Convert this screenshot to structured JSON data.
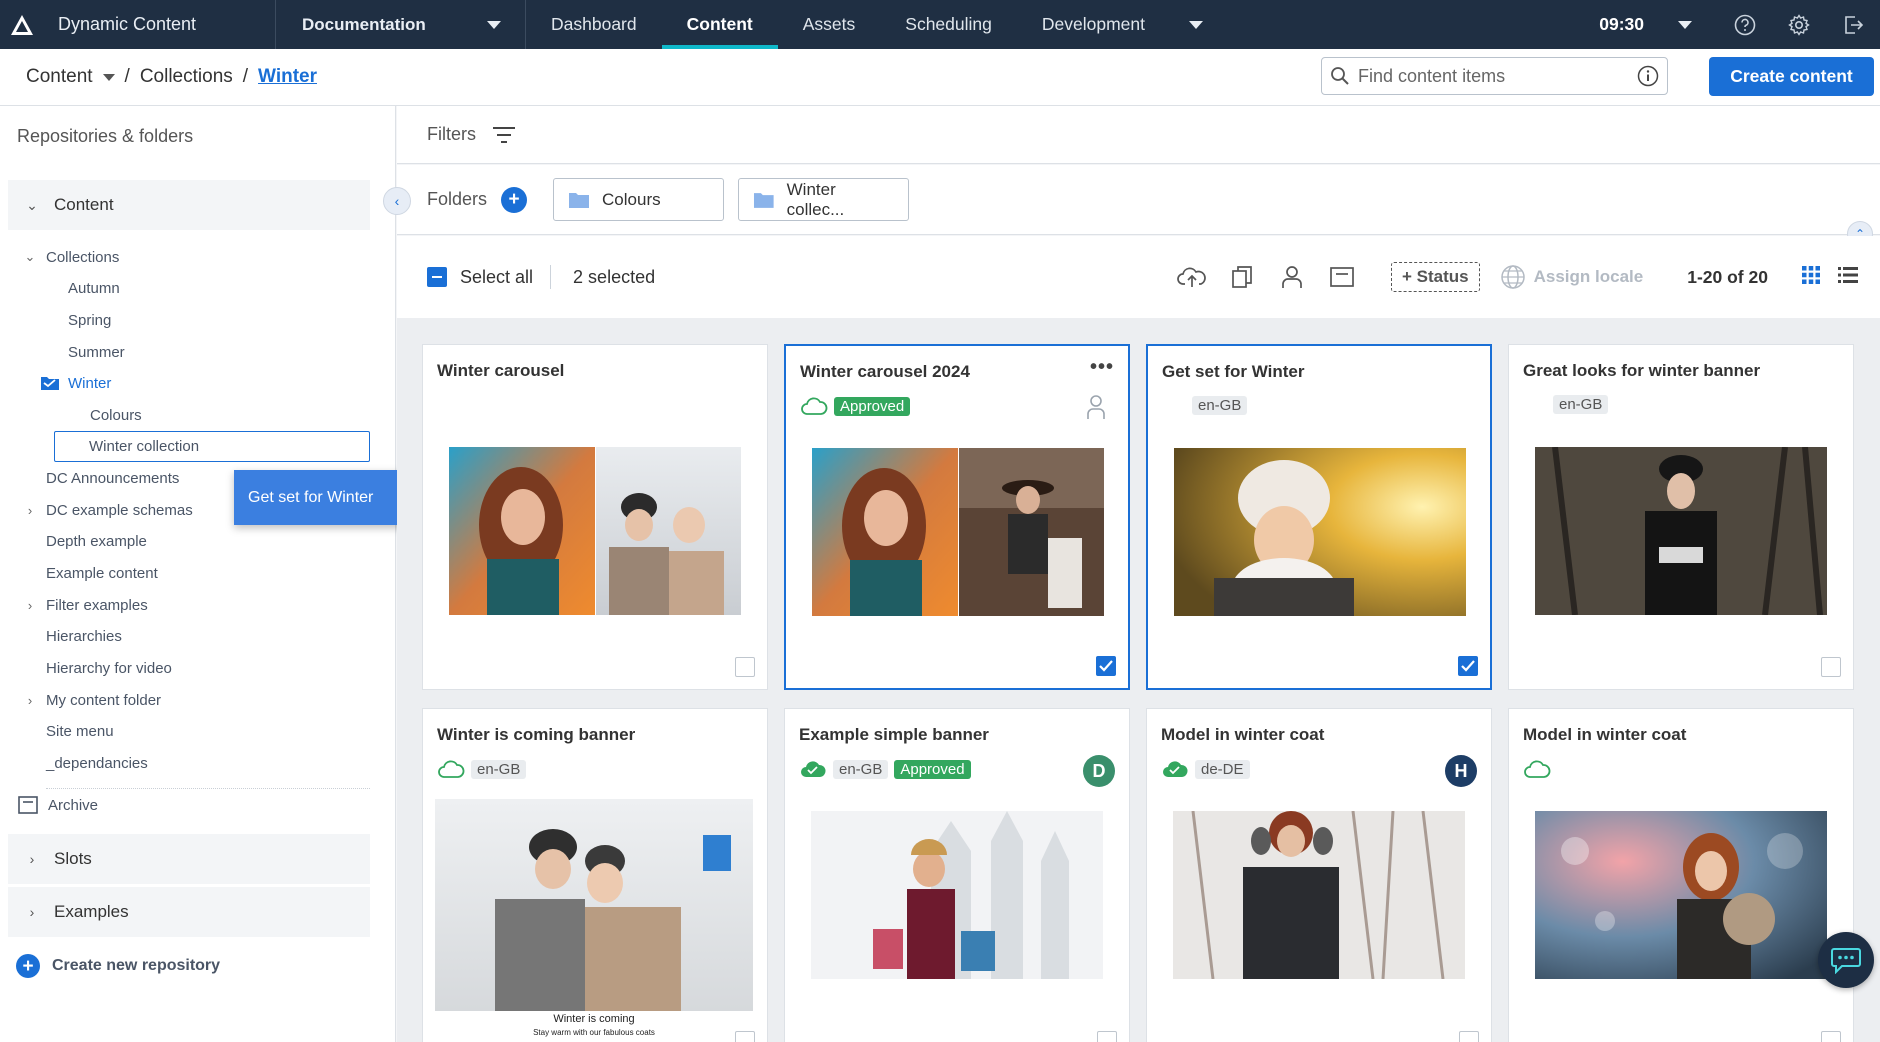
{
  "app": {
    "name": "Dynamic Content",
    "section": "Documentation",
    "clock": "09:30"
  },
  "nav": {
    "tabs": [
      "Dashboard",
      "Content",
      "Assets",
      "Scheduling",
      "Development"
    ]
  },
  "breadcrumb": {
    "root": "Content",
    "mid": "Collections",
    "current": "Winter"
  },
  "search": {
    "placeholder": "Find content items"
  },
  "create_button": "Create content",
  "sidebar": {
    "title": "Repositories & folders",
    "content_repo": "Content",
    "tree": [
      "Collections",
      "Autumn",
      "Spring",
      "Summer",
      "Winter",
      "Colours",
      "Winter collection",
      "DC Announcements",
      "DC example schemas",
      "Depth example",
      "Example content",
      "Filter examples",
      "Hierarchies",
      "Hierarchy for video",
      "My content folder",
      "Site menu",
      "_dependancies"
    ],
    "archive": "Archive",
    "slots_repo": "Slots",
    "examples_repo": "Examples",
    "new_repo": "Create new repository"
  },
  "drag": {
    "label": "Get set for Winter",
    "count": "2"
  },
  "filters": {
    "label": "Filters"
  },
  "folders": {
    "label": "Folders",
    "chips": [
      "Colours",
      "Winter collec..."
    ]
  },
  "toolbar": {
    "select_all": "Select all",
    "selected": "2 selected",
    "status": "+ Status",
    "assign_locale": "Assign locale",
    "range": "1-20 of 20"
  },
  "cards": [
    {
      "title": "Winter carousel"
    },
    {
      "title": "Winter carousel 2024",
      "status": "Approved"
    },
    {
      "title": "Get set for Winter",
      "locale": "en-GB"
    },
    {
      "title": "Great looks for winter banner",
      "locale": "en-GB"
    },
    {
      "title": "Winter is coming banner",
      "locale": "en-GB",
      "caption": "Winter is coming",
      "subcaption": "Stay warm with our fabulous coats"
    },
    {
      "title": "Example simple banner",
      "locale": "en-GB",
      "status": "Approved",
      "avatar": "D"
    },
    {
      "title": "Model in winter coat",
      "locale": "de-DE",
      "avatar": "H"
    },
    {
      "title": "Model in winter coat"
    }
  ],
  "colors": {
    "nav_bg": "#1f2f43",
    "accent": "#1a6fd6",
    "teal": "#0fb8c9",
    "approved": "#33a75e",
    "drag_badge": "#f39c2b"
  }
}
